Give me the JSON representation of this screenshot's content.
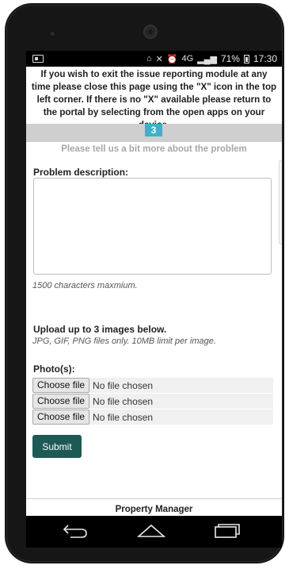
{
  "notice": "If you wish to exit the issue reporting module at any time please close this page using the \"X\" icon in the top left corner. If there is no \"X\" available please return to the portal by selecting from the open apps on your device.",
  "statusbar": {
    "battery": "71%",
    "time": "17:30",
    "network": "4G"
  },
  "progress": {
    "step": "3"
  },
  "form": {
    "subtitle": "Please tell us a bit more about the problem",
    "description_label": "Problem description:",
    "description_value": "",
    "char_limit_note": "1500 characters maxmium.",
    "upload_title": "Upload up to 3 images below.",
    "upload_hint": "JPG, GIF, PNG files only. 10MB limit per image.",
    "photos_label": "Photo(s):",
    "file_inputs": [
      {
        "button": "Choose file",
        "status": "No file chosen"
      },
      {
        "button": "Choose file",
        "status": "No file chosen"
      },
      {
        "button": "Choose file",
        "status": "No file chosen"
      }
    ],
    "submit_label": "Submit"
  },
  "footer": {
    "text": "Property Manager"
  },
  "colors": {
    "step_badge": "#3fb0c9",
    "submit_button": "#1d5a56",
    "step_bar": "#cfcfcf"
  },
  "icons": {
    "nav_back": "back-arrow-icon",
    "nav_home": "home-icon",
    "nav_recent": "recent-apps-icon"
  }
}
